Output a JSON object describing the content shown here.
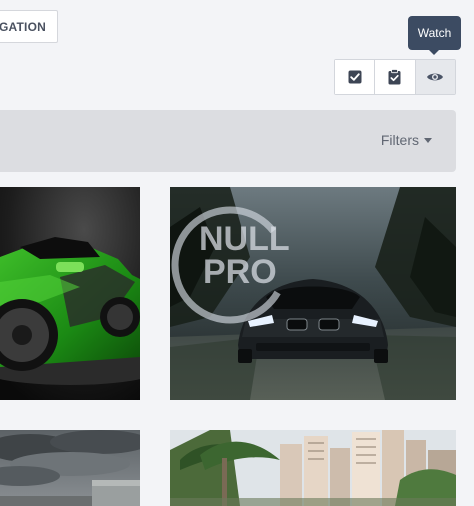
{
  "toolbar": {
    "navigation_label": "IGATION",
    "tooltip": "Watch",
    "buttons": [
      {
        "icon": "checkbox-checked-icon"
      },
      {
        "icon": "clipboard-check-icon"
      },
      {
        "icon": "eye-icon"
      }
    ]
  },
  "filter_bar": {
    "filters_label": "Filters"
  },
  "gallery": {
    "tiles": [
      {
        "subject": "green-sports-car"
      },
      {
        "subject": "black-bmw",
        "watermark": {
          "line1": "NULL",
          "line2": "PRO"
        }
      },
      {
        "subject": "stormy-sky"
      },
      {
        "subject": "palm-trees-city"
      }
    ]
  }
}
